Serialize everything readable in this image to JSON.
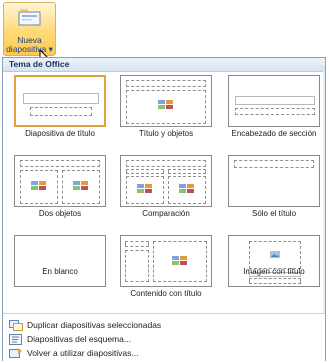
{
  "ribbon_button": {
    "line1": "Nueva",
    "line2": "diapositiva",
    "dropdown_glyph": "▾",
    "icon": "new-slide-icon"
  },
  "gallery": {
    "section_title": "Tema de Office",
    "layouts": [
      {
        "label": "Diapositiva de título"
      },
      {
        "label": "Título y objetos"
      },
      {
        "label": "Encabezado de sección"
      },
      {
        "label": "Dos objetos"
      },
      {
        "label": "Comparación"
      },
      {
        "label": "Sólo el título"
      },
      {
        "label": "En blanco"
      },
      {
        "label": "Contenido con título"
      },
      {
        "label": "Imagen con título"
      }
    ]
  },
  "menu": {
    "items": [
      {
        "label": "Duplicar diapositivas seleccionadas",
        "icon": "duplicate-slides-icon"
      },
      {
        "label": "Diapositivas del esquema...",
        "icon": "outline-slides-icon"
      },
      {
        "label": "Volver a utilizar diapositivas...",
        "icon": "reuse-slides-icon"
      }
    ]
  },
  "colors": {
    "accent_border": "#e2a33a",
    "header_text": "#15325d"
  }
}
